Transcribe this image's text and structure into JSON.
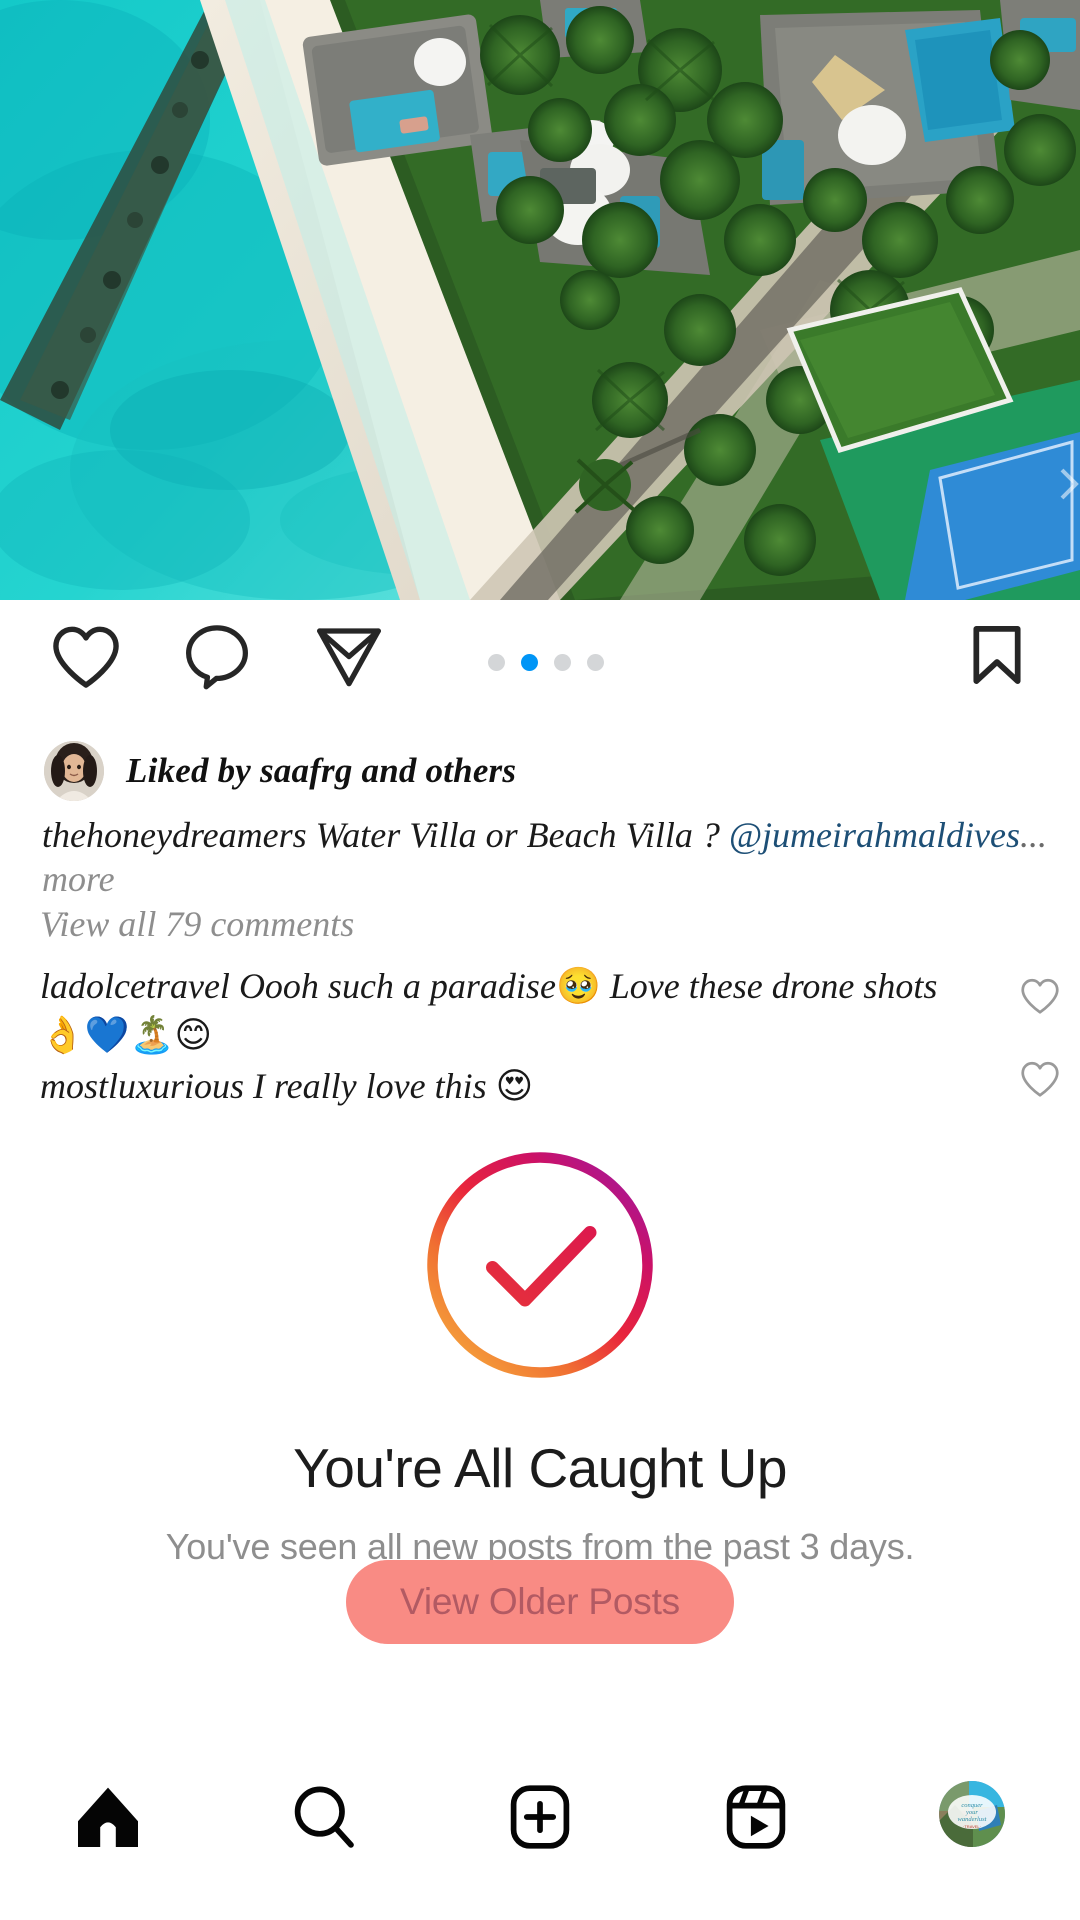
{
  "post": {
    "photo_alt": "aerial-drone-view-maldives-resort-beach-villas",
    "carousel": {
      "total": 4,
      "active_index": 1
    },
    "actions": {
      "like_label": "Like",
      "comment_label": "Comment",
      "share_label": "Share",
      "save_label": "Save"
    },
    "liked_by": "Liked by saafrg and others",
    "liker_avatar_name": "saafrg-avatar",
    "caption": {
      "username": "thehoneydreamers",
      "text": " Water Villa or Beach Villa ? ",
      "mention": "@jumeirahmaldives",
      "ellipsis": "...",
      "more_label": "more"
    },
    "view_all_comments": "View all 79 comments",
    "comment_count": 79,
    "comments": [
      {
        "username": "ladolcetravel",
        "text": " Oooh such a paradise",
        "emoji_inline": "🥹",
        "text2": " Love these drone shots ",
        "emoji_trail": "👌💙🏝️😊"
      },
      {
        "username": "mostluxurious",
        "text": " I really love this ",
        "emoji_inline": "😍",
        "text2": "",
        "emoji_trail": ""
      }
    ]
  },
  "caught_up": {
    "icon_name": "check-circle-gradient-icon",
    "title": "You're All Caught Up",
    "subtitle": "You've seen all new posts from the past 3 days.",
    "button_label": "View Older Posts"
  },
  "bottom_nav": {
    "items": [
      {
        "name": "home",
        "label": "Home",
        "icon": "home-icon",
        "active": true
      },
      {
        "name": "search",
        "label": "Search",
        "icon": "search-icon",
        "active": false
      },
      {
        "name": "create",
        "label": "Create",
        "icon": "plus-box-icon",
        "active": false
      },
      {
        "name": "reels",
        "label": "Reels",
        "icon": "reels-icon",
        "active": false
      },
      {
        "name": "profile",
        "label": "Profile",
        "icon": "profile-avatar",
        "active": false
      }
    ],
    "profile_avatar_text": "conquer your wanderlust"
  },
  "colors": {
    "instagram_blue": "#0095f6",
    "dot_inactive": "#d4d6d8",
    "mention_link": "#1d4f76",
    "muted_text": "#8e8e8e",
    "button_bg": "#f98b84",
    "button_text": "#b25a63",
    "gradient_top": "#a4179b",
    "gradient_mid": "#e8203a",
    "gradient_bottom": "#f2a43a"
  }
}
